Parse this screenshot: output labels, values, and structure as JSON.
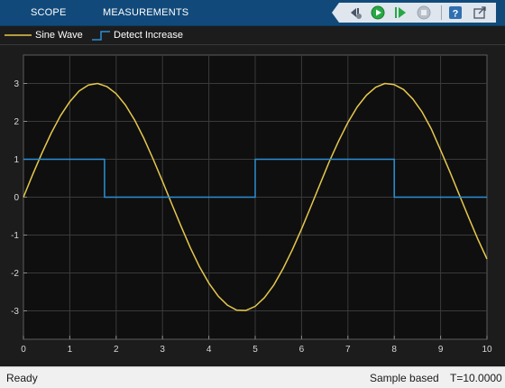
{
  "toolstrip": {
    "tabs": [
      {
        "label": "SCOPE"
      },
      {
        "label": "MEASUREMENTS"
      }
    ],
    "quick_access": [
      "step-back-icon",
      "run-icon",
      "step-forward-icon",
      "stop-icon",
      "help-icon",
      "undock-icon"
    ]
  },
  "legend": {
    "items": [
      {
        "label": "Sine Wave",
        "color": "#e6c84d"
      },
      {
        "label": "Detect Increase",
        "color": "#2b8fd6"
      }
    ]
  },
  "status": {
    "left": "Ready",
    "mode": "Sample based",
    "time": "T=10.0000"
  },
  "chart_data": {
    "type": "line",
    "x_ticks": [
      "0",
      "1",
      "2",
      "3",
      "4",
      "5",
      "6",
      "7",
      "8",
      "9",
      "10"
    ],
    "y_ticks": [
      "3",
      "2",
      "1",
      "0",
      "-1",
      "-2",
      "-3"
    ],
    "xlim": [
      0,
      10
    ],
    "ylim": [
      -3.75,
      3.75
    ],
    "grid": true,
    "series": [
      {
        "name": "Sine Wave",
        "color": "#e6c84d",
        "step": false,
        "x": [
          0,
          0.2,
          0.4,
          0.6,
          0.8,
          1.0,
          1.2,
          1.4,
          1.6,
          1.8,
          2.0,
          2.2,
          2.4,
          2.6,
          2.8,
          3.0,
          3.2,
          3.4,
          3.6,
          3.8,
          4.0,
          4.2,
          4.4,
          4.6,
          4.8,
          5.0,
          5.2,
          5.4,
          5.6,
          5.8,
          6.0,
          6.2,
          6.4,
          6.6,
          6.8,
          7.0,
          7.2,
          7.4,
          7.6,
          7.8,
          8.0,
          8.2,
          8.4,
          8.6,
          8.8,
          9.0,
          9.2,
          9.4,
          9.6,
          9.8,
          10.0
        ],
        "y": [
          0,
          0.6,
          1.17,
          1.69,
          2.15,
          2.52,
          2.8,
          2.96,
          3.0,
          2.92,
          2.73,
          2.43,
          2.03,
          1.55,
          1.0,
          0.42,
          -0.18,
          -0.77,
          -1.33,
          -1.84,
          -2.27,
          -2.61,
          -2.85,
          -2.98,
          -2.99,
          -2.88,
          -2.65,
          -2.32,
          -1.89,
          -1.39,
          -0.84,
          -0.25,
          0.35,
          0.94,
          1.48,
          1.97,
          2.38,
          2.69,
          2.9,
          3.0,
          2.97,
          2.84,
          2.59,
          2.25,
          1.8,
          1.24,
          0.67,
          0.07,
          -0.52,
          -1.1,
          -1.63
        ]
      },
      {
        "name": "Detect Increase",
        "color": "#2b8fd6",
        "step": true,
        "x": [
          0,
          1.75,
          1.75,
          5.0,
          5.0,
          8.0,
          8.0,
          10.0
        ],
        "y": [
          1,
          1,
          0,
          0,
          1,
          1,
          0,
          0
        ]
      }
    ]
  }
}
